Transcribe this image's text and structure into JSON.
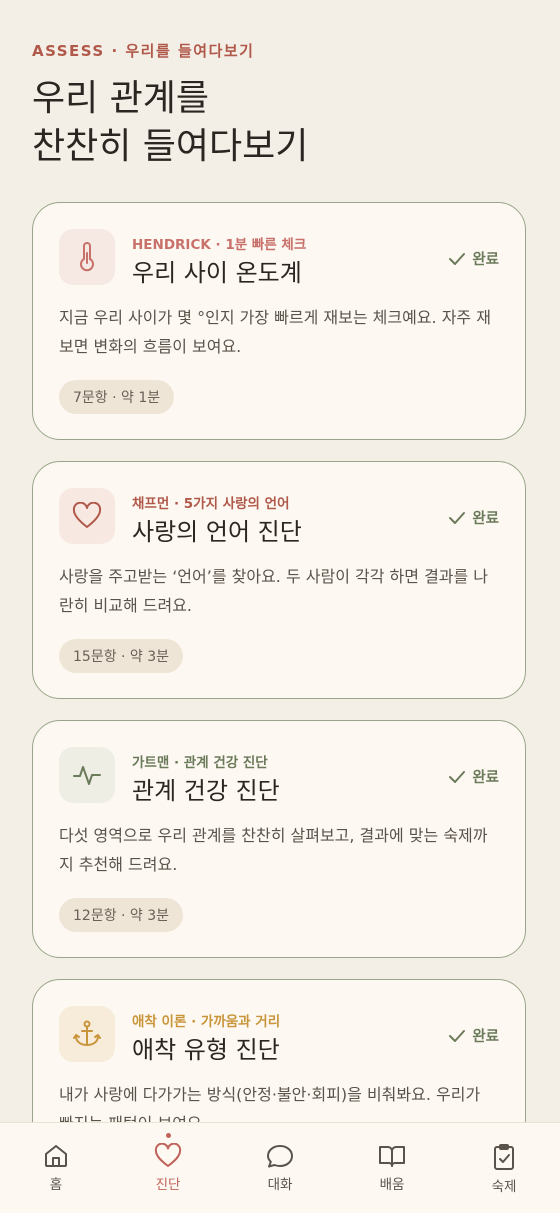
{
  "header": {
    "eyebrow": "ASSESS · 우리를 들여다보기",
    "title_line1": "우리 관계를",
    "title_line2": "찬찬히 들여다보기"
  },
  "cards": [
    {
      "icon": "thermometer-icon",
      "source": "HENDRICK · 1분 빠른 체크",
      "title": "우리 사이 온도계",
      "status": "완료",
      "description": "지금 우리 사이가 몇 °인지 가장 빠르게 재보는 체크예요. 자주 재보면 변화의 흐름이 보여요.",
      "meta": "7문항 · 약 1분",
      "accent": "#c8706a"
    },
    {
      "icon": "heart-icon",
      "source": "채프먼 · 5가지 사랑의 언어",
      "title": "사랑의 언어 진단",
      "status": "완료",
      "description": "사랑을 주고받는 ‘언어’를 찾아요. 두 사람이 각각 하면 결과를 나란히 비교해 드려요.",
      "meta": "15문항 · 약 3분",
      "accent": "#b0594a"
    },
    {
      "icon": "pulse-icon",
      "source": "가트맨 · 관계 건강 진단",
      "title": "관계 건강 진단",
      "status": "완료",
      "description": "다섯 영역으로 우리 관계를 찬찬히 살펴보고, 결과에 맞는 숙제까지 추천해 드려요.",
      "meta": "12문항 · 약 3분",
      "accent": "#6b7a5a"
    },
    {
      "icon": "anchor-icon",
      "source": "애착 이론 · 가까움과 거리",
      "title": "애착 유형 진단",
      "status": "완료",
      "description": "내가 사랑에 다가가는 방식(안정·불안·회피)을 비춰봐요. 우리가 빠지는 패턴이 보여요.",
      "meta": "",
      "accent": "#c9953a"
    }
  ],
  "tabbar": {
    "items": [
      {
        "label": "홈",
        "icon": "home-icon"
      },
      {
        "label": "진단",
        "icon": "heart-icon",
        "active": true
      },
      {
        "label": "대화",
        "icon": "chat-bubble-icon"
      },
      {
        "label": "배움",
        "icon": "book-icon"
      },
      {
        "label": "숙제",
        "icon": "clipboard-check-icon"
      }
    ]
  },
  "colors": {
    "background": "#f4efe6",
    "card": "#fdf9f2",
    "card_border": "#9aa68a",
    "eyebrow": "#b0594a",
    "active_tab": "#c0625a",
    "status_green": "#6b7a5a"
  }
}
